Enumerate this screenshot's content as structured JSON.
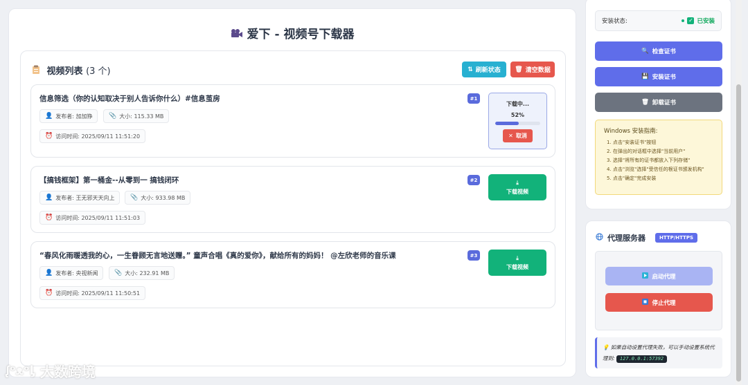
{
  "app_title": "爱下 - 视频号下载器",
  "list": {
    "title": "视频列表",
    "count_text": "(3 个)",
    "refresh_label": "刷新状态",
    "clear_label": "清空数据"
  },
  "videos": [
    {
      "title": "信息筛选（你的认知取决于别人告诉你什么）#信息茧房",
      "publisher": "发布者: 加加狰",
      "size": "大小: 115.33 MB",
      "visit_time": "访问时间: 2025/09/11 11:51:20",
      "index": "#1",
      "status": "downloading",
      "progress_label": "下载中...",
      "progress_text": "52%",
      "progress": 0.52,
      "cancel_label": "取消"
    },
    {
      "title": "【搞钱框架】第一桶金--从零到一 搞钱闭环",
      "publisher": "发布者: 王无邪天天向上",
      "size": "大小: 933.98 MB",
      "visit_time": "访问时间: 2025/09/11 11:51:03",
      "index": "#2",
      "download_label": "下载视频"
    },
    {
      "title": "“春风化雨暖透我的心，一生眷顾无言地送赠。” 童声合唱《真的爱你》，献给所有的妈妈！ @左欣老师的音乐课",
      "publisher": "发布者: 央视新闻",
      "size": "大小: 232.91 MB",
      "visit_time": "访问时间: 2025/09/11 11:50:51",
      "index": "#3",
      "download_label": "下载视频"
    }
  ],
  "cert": {
    "install_status_label": "安装状态:",
    "install_status_value": "已安装",
    "check_label": "检查证书",
    "install_label": "安装证书",
    "uninstall_label": "卸载证书",
    "guide_title": "Windows 安装指南:",
    "guide_steps": [
      "1. 点击\"安装证书\"按钮",
      "2. 在弹出的对话框中选择\"当前用户\"",
      "3. 选择\"将所有的证书都放入下列存储\"",
      "4. 点击\"浏览\"选择\"受信任的根证书颁发机构\"",
      "5. 点击\"确定\"完成安装"
    ]
  },
  "proxy": {
    "title": "代理服务器",
    "badge": "HTTP/HTTPS",
    "start_label": "启动代理",
    "stop_label": "停止代理",
    "note_text": "如果自动设置代理失败，可以手动设置系统代理到:",
    "address": "127.0.0.1:57392"
  },
  "watermark": "大数跨境",
  "colors": {
    "primary": "#5f6dea",
    "success": "#12b27a",
    "danger": "#e6574d",
    "info": "#27b0d1"
  }
}
